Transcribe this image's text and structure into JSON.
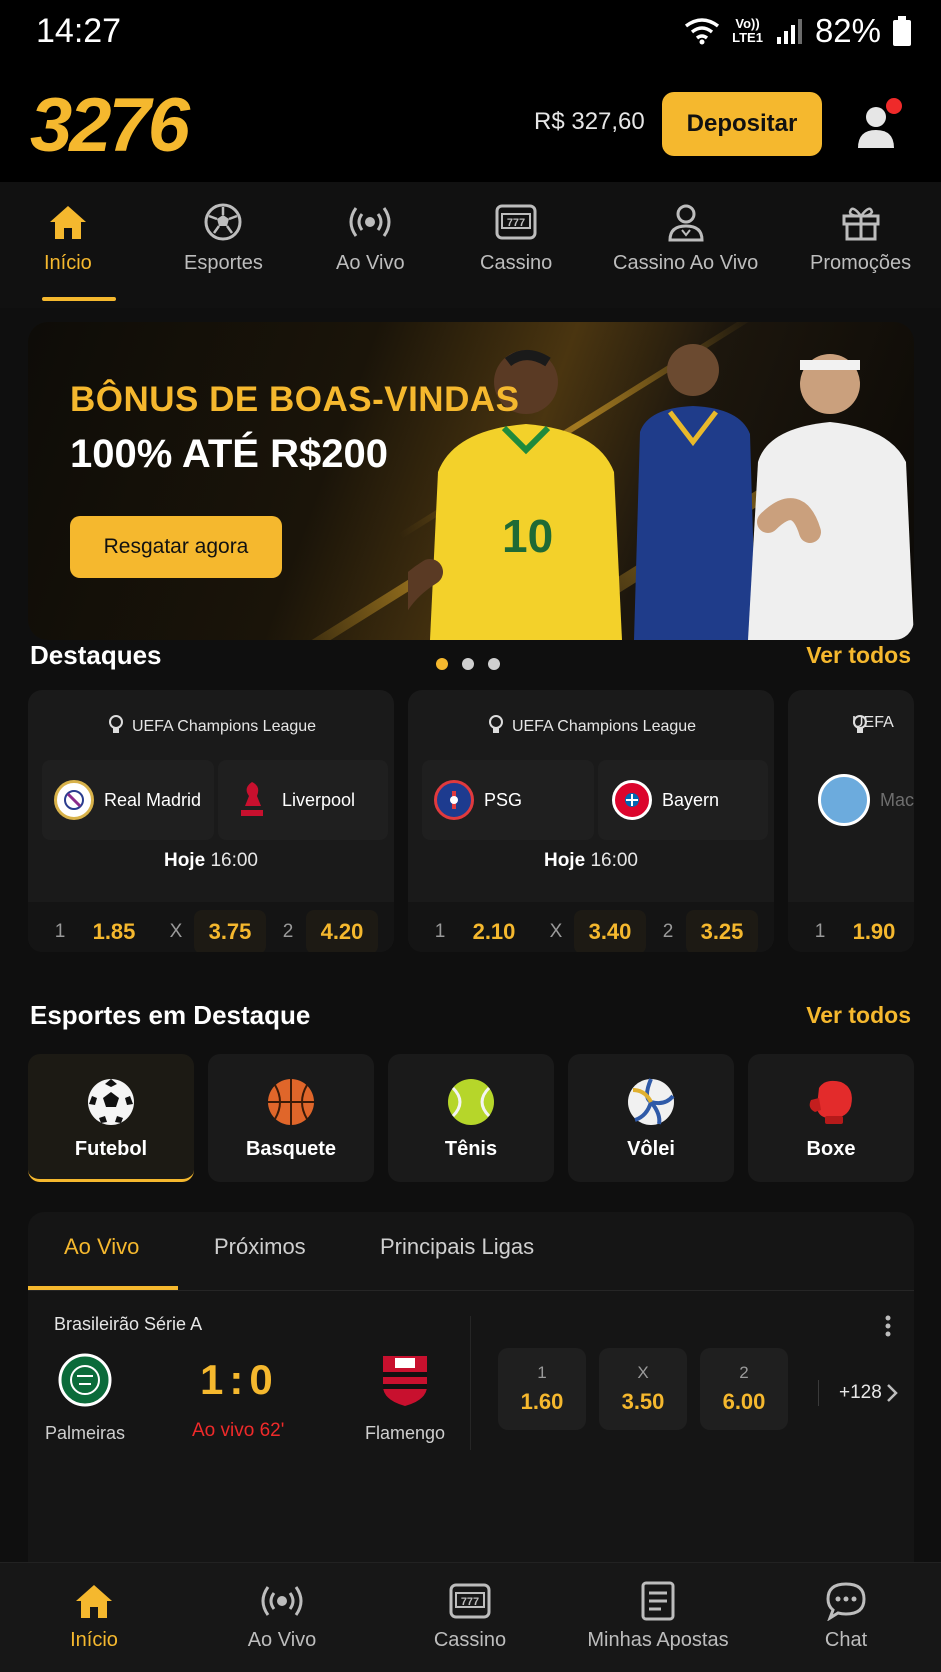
{
  "status_bar": {
    "time": "14:27",
    "network": "LTE1",
    "volte": "Vo))",
    "battery": "82%"
  },
  "header": {
    "logo": "3276",
    "balance": "R$ 327,60",
    "deposit_label": "Depositar"
  },
  "main_nav": [
    {
      "label": "Início",
      "icon": "home-icon",
      "active": true
    },
    {
      "label": "Esportes",
      "icon": "soccer-ball-icon"
    },
    {
      "label": "Ao Vivo",
      "icon": "broadcast-icon"
    },
    {
      "label": "Cassino",
      "icon": "slot-machine-icon"
    },
    {
      "label": "Cassino Ao Vivo",
      "icon": "dealer-icon"
    },
    {
      "label": "Promoções",
      "icon": "gift-icon"
    }
  ],
  "banner": {
    "title": "BÔNUS DE BOAS-VINDAS",
    "subtitle": "100% ATÉ R$200",
    "cta": "Resgatar agora",
    "slides": 3,
    "active_slide": 1
  },
  "highlights": {
    "title": "Destaques",
    "see_all": "Ver todos",
    "matches": [
      {
        "league": "UEFA Champions League",
        "home": "Real Madrid",
        "away": "Liverpool",
        "day": "Hoje",
        "time": "16:00",
        "odds": [
          {
            "label": "1",
            "value": "1.85"
          },
          {
            "label": "X",
            "value": "3.75"
          },
          {
            "label": "2",
            "value": "4.20"
          }
        ]
      },
      {
        "league": "UEFA Champions League",
        "home": "PSG",
        "away": "Bayern",
        "day": "Hoje",
        "time": "16:00",
        "odds": [
          {
            "label": "1",
            "value": "2.10"
          },
          {
            "label": "X",
            "value": "3.40"
          },
          {
            "label": "2",
            "value": "3.25"
          }
        ]
      },
      {
        "league": "UEFA",
        "home": "Mac",
        "odds": [
          {
            "label": "1",
            "value": "1.90"
          }
        ]
      }
    ]
  },
  "sports": {
    "title": "Esportes em Destaque",
    "see_all": "Ver todos",
    "items": [
      {
        "label": "Futebol",
        "icon": "soccer-ball-icon",
        "active": true
      },
      {
        "label": "Basquete",
        "icon": "basketball-icon"
      },
      {
        "label": "Tênis",
        "icon": "tennis-ball-icon"
      },
      {
        "label": "Vôlei",
        "icon": "volleyball-icon"
      },
      {
        "label": "Boxe",
        "icon": "boxing-glove-icon"
      }
    ]
  },
  "live": {
    "tabs": [
      "Ao Vivo",
      "Próximos",
      "Principais Ligas"
    ],
    "active_tab": 0,
    "match": {
      "league": "Brasileirão Série A",
      "home": "Palmeiras",
      "away": "Flamengo",
      "score_home": "1",
      "score_sep": ":",
      "score_away": "0",
      "status": "Ao vivo 62'",
      "odds": [
        {
          "label": "1",
          "value": "1.60"
        },
        {
          "label": "X",
          "value": "3.50"
        },
        {
          "label": "2",
          "value": "6.00"
        }
      ],
      "more_markets": "+128"
    }
  },
  "bottom_nav": [
    {
      "label": "Início",
      "icon": "home-icon",
      "active": true
    },
    {
      "label": "Ao Vivo",
      "icon": "broadcast-icon"
    },
    {
      "label": "Cassino",
      "icon": "slot-machine-icon"
    },
    {
      "label": "Minhas Apostas",
      "icon": "betslip-icon"
    },
    {
      "label": "Chat",
      "icon": "chat-bubble-icon"
    }
  ],
  "colors": {
    "accent": "#f5b82e",
    "live_red": "#ef2a2a",
    "background": "#0f0f0f",
    "card": "#1a1a1a"
  }
}
